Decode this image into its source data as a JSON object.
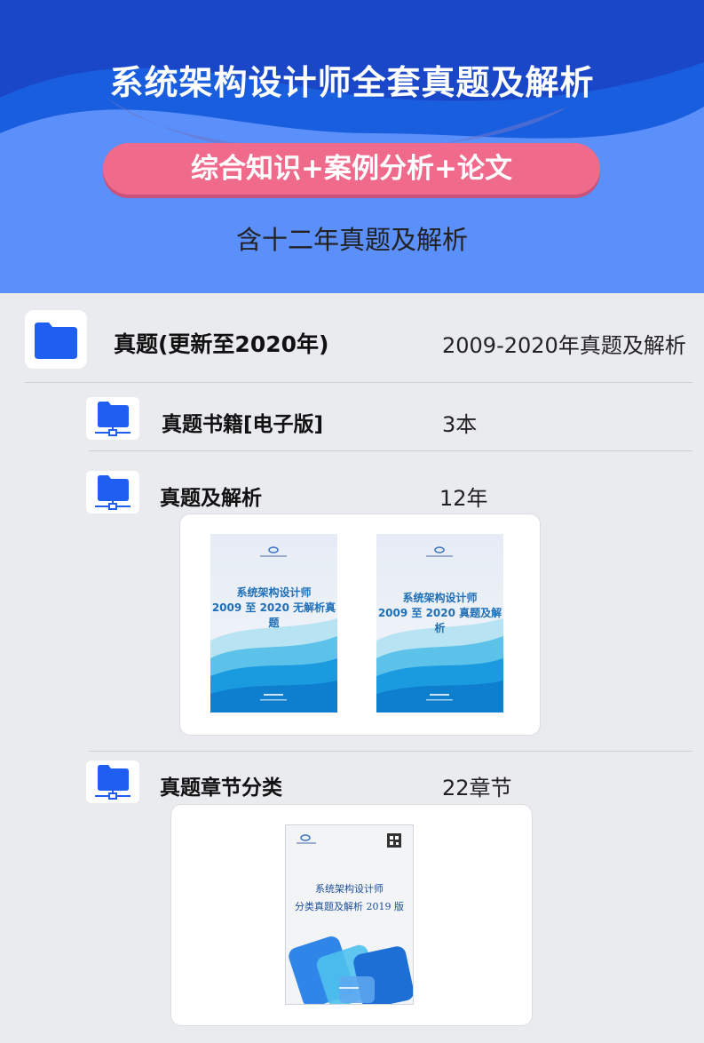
{
  "header": {
    "title": "系统架构设计师全套真题及解析",
    "pill_label": "综合知识+案例分析+论文",
    "subtitle": "含十二年真题及解析"
  },
  "sections": [
    {
      "title": "真题(更新至2020年)",
      "value": "2009-2020年真题及解析",
      "icon": "folder-icon"
    },
    {
      "title": "真题书籍[电子版]",
      "value": "3本",
      "icon": "network-folder-icon"
    },
    {
      "title": "真题及解析",
      "value": "12年",
      "icon": "network-folder-icon"
    },
    {
      "title": "真题章节分类",
      "value": "22章节",
      "icon": "network-folder-icon"
    }
  ],
  "books": [
    {
      "line1": "系统架构设计师",
      "line2": "2009 至 2020 无解析真题"
    },
    {
      "line1": "系统架构设计师",
      "line2": "2009 至 2020 真题及解析"
    },
    {
      "line1": "系统架构设计师",
      "line2": "分类真题及解析 2019 版"
    }
  ],
  "colors": {
    "header_blue": "#5b8ff9",
    "wave_dark": "#1a47c8",
    "pill_pink": "#f06a8c",
    "folder_blue": "#1e5ef0",
    "background": "#eaebee"
  }
}
